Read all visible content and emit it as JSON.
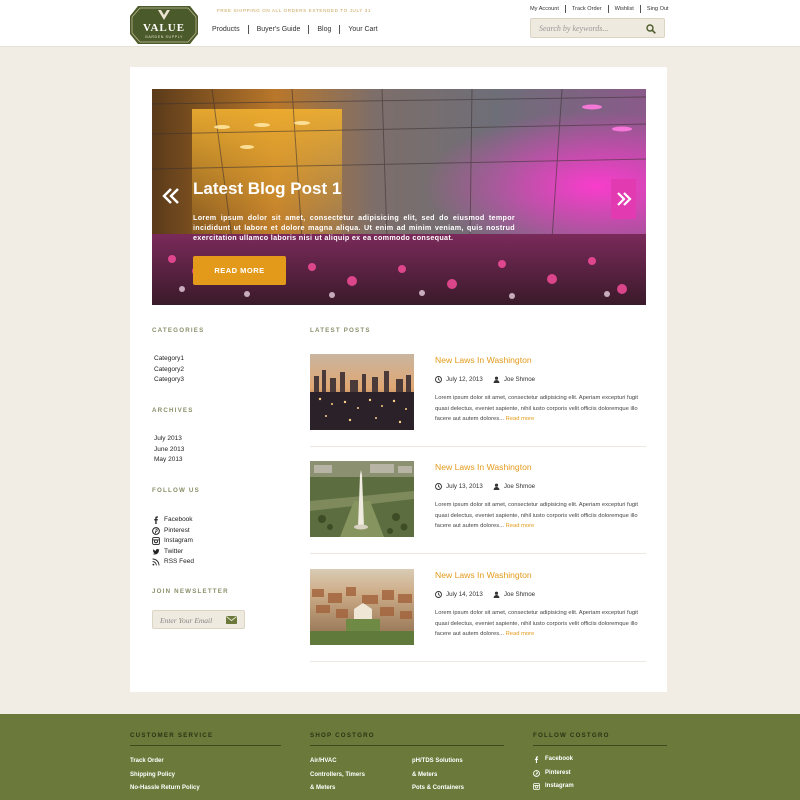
{
  "header": {
    "logo_text": "VALUE",
    "logo_subtext": "GARDEN SUPPLY",
    "promo": "FREE SHIPPING ON ALL ORDERS EXTENDED TO JULY 31",
    "main_nav": [
      "Products",
      "Buyer's Guide",
      "Blog",
      "Your Cart"
    ],
    "top_nav": [
      "My Account",
      "Track Order",
      "Wishlist",
      "Sing Out"
    ],
    "search_placeholder": "Search by keywords..."
  },
  "hero": {
    "title": "Latest Blog Post 1",
    "text": "Lorem ipsum dolor sit amet, consectetur adipisicing elit, sed do eiusmod tempor incididunt ut labore et dolore magna aliqua. Ut enim ad minim veniam, quis nostrud exercitation ullamco laboris nisi ut aliquip ex ea commodo consequat.",
    "button": "READ MORE"
  },
  "sidebar": {
    "categories_title": "CATEGORIES",
    "categories": [
      "Category1",
      "Category2",
      "Category3"
    ],
    "archives_title": "ARCHIVES",
    "archives": [
      "July 2013",
      "June 2013",
      "May 2013"
    ],
    "follow_title": "FOLLOW US",
    "follow": [
      "Facebook",
      "Pinterest",
      "Instagram",
      "Twitter",
      "RSS Feed"
    ],
    "newsletter_title": "JOIN NEWSLETTER",
    "newsletter_placeholder": "Enter Your Email"
  },
  "latest_title": "LATEST POSTS",
  "posts": [
    {
      "title": "New Laws In Washington",
      "date": "July 12, 2013",
      "author": "Joe Shmoe",
      "excerpt": "Lorem ipsum dolor sit amet, consectetur adipisicing elit. Aperiam excepturi fugit quasi delectus, eveniet sapiente, nihil iusto corporis velit officiis doloremque illo facere aut autem dolores...",
      "more": "Read more"
    },
    {
      "title": "New Laws In Washington",
      "date": "July 13, 2013",
      "author": "Joe Shmoe",
      "excerpt": "Lorem ipsum dolor sit amet, consectetur adipisicing elit. Aperiam excepturi fugit quasi delectus, eveniet sapiente, nihil iusto corporis velit officiis doloremque illo facere aut autem dolores...",
      "more": "Read more"
    },
    {
      "title": "New Laws In Washington",
      "date": "July 14, 2013",
      "author": "Joe Shmoe",
      "excerpt": "Lorem ipsum dolor sit amet, consectetur adipisicing elit. Aperiam excepturi fugit quasi delectus, eveniet sapiente, nihil iusto corporis velit officiis doloremque illo facere aut autem dolores...",
      "more": "Read more"
    }
  ],
  "footer": {
    "customer_service_title": "CUSTOMER SERVICE",
    "customer_service": [
      "Track Order",
      "Shipping Policy",
      "No-Hassle Return Policy"
    ],
    "shop_title": "SHOP COSTGRO",
    "shop_col1": [
      "Air/HVAC",
      "Controllers, Timers",
      "& Meters"
    ],
    "shop_col2": [
      "pH/TDS Solutions",
      "& Meters",
      "Pots & Containers"
    ],
    "follow_title": "FOLLOW COSTGRO",
    "follow": [
      "Facebook",
      "Pinterest",
      "Instagram"
    ]
  },
  "colors": {
    "accent": "#e39a1a",
    "olive": "#6b7a3a",
    "logo_green": "#4b5a2a",
    "magenta": "#e23ab0",
    "background": "#f2ede4"
  }
}
